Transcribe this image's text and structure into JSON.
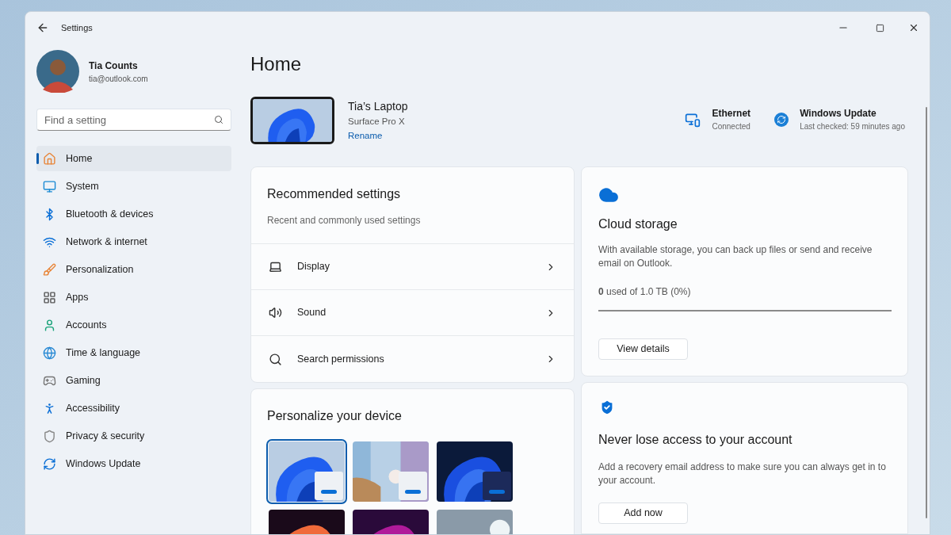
{
  "window": {
    "title": "Settings"
  },
  "user": {
    "name": "Tia Counts",
    "email": "tia@outlook.com"
  },
  "search": {
    "placeholder": "Find a setting"
  },
  "sidebar": {
    "items": [
      {
        "label": "Home",
        "selected": true
      },
      {
        "label": "System",
        "selected": false
      },
      {
        "label": "Bluetooth & devices",
        "selected": false
      },
      {
        "label": "Network & internet",
        "selected": false
      },
      {
        "label": "Personalization",
        "selected": false
      },
      {
        "label": "Apps",
        "selected": false
      },
      {
        "label": "Accounts",
        "selected": false
      },
      {
        "label": "Time & language",
        "selected": false
      },
      {
        "label": "Gaming",
        "selected": false
      },
      {
        "label": "Accessibility",
        "selected": false
      },
      {
        "label": "Privacy & security",
        "selected": false
      },
      {
        "label": "Windows Update",
        "selected": false
      }
    ]
  },
  "page_title": "Home",
  "device": {
    "name": "Tia’s Laptop",
    "model": "Surface Pro X",
    "rename": "Rename"
  },
  "status": [
    {
      "title": "Ethernet",
      "detail": "Connected"
    },
    {
      "title": "Windows Update",
      "detail": "Last checked: 59 minutes ago"
    }
  ],
  "recommended": {
    "title": "Recommended settings",
    "subtitle": "Recent and commonly used settings",
    "items": [
      {
        "label": "Display"
      },
      {
        "label": "Sound"
      },
      {
        "label": "Search permissions"
      }
    ]
  },
  "personalize": {
    "title": "Personalize your device",
    "themes": [
      {
        "kind": "picture",
        "selected": true
      },
      {
        "kind": "picture",
        "selected": false
      },
      {
        "kind": "picture",
        "selected": false
      },
      {
        "kind": "picture",
        "selected": false
      },
      {
        "kind": "picture",
        "selected": false
      },
      {
        "kind": "picture",
        "selected": false
      }
    ]
  },
  "cloud": {
    "title": "Cloud storage",
    "text": "With available storage, you can back up files or send and receive email on Outlook.",
    "usage": "**0** used of 1.0 TB (0%)",
    "level": 0,
    "button": "View details"
  },
  "account": {
    "title": "Never lose access to your account",
    "text": "Add a recovery email address to make sure you can always get in to your account.",
    "button": "Add now"
  }
}
